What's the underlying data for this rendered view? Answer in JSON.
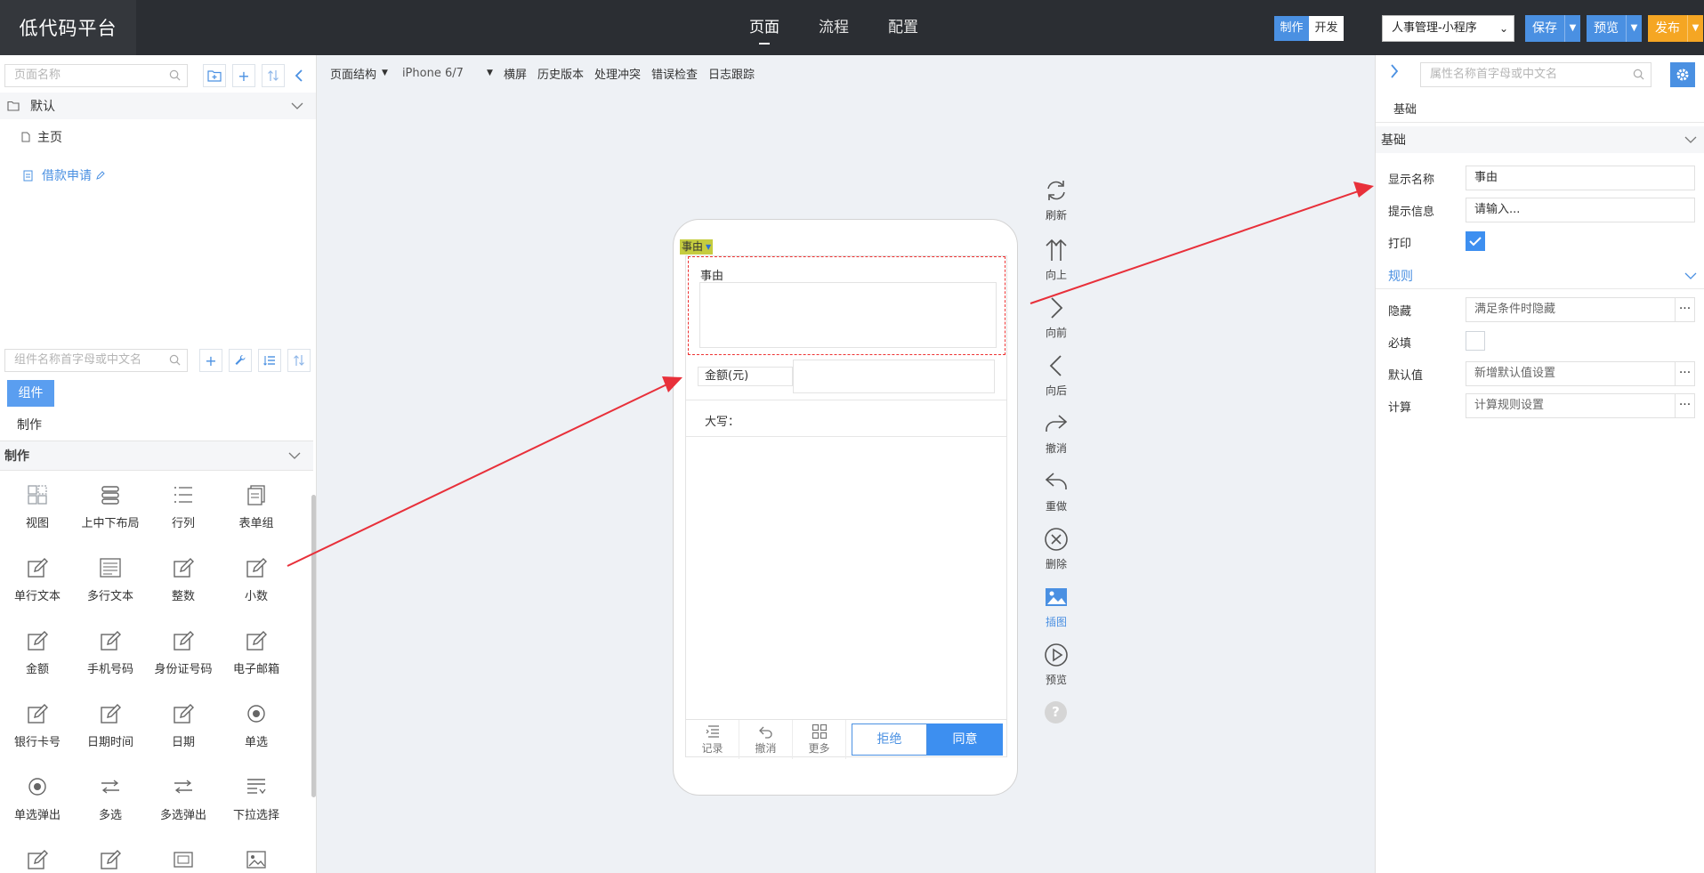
{
  "app": {
    "title": "低代码平台"
  },
  "nav": {
    "items": [
      "页面",
      "流程",
      "配置"
    ],
    "active": 0
  },
  "mode": {
    "make": "制作",
    "dev": "开发"
  },
  "app_select": {
    "value": "人事管理-小程序"
  },
  "actions": {
    "save": "保存",
    "preview": "预览",
    "publish": "发布"
  },
  "colors": {
    "accent": "#4a90e2",
    "publish": "#f5a623",
    "topbar": "#2b2e33",
    "selection": "#c5cc3f"
  },
  "left": {
    "page_search_placeholder": "页面名称",
    "tree": {
      "group": "默认",
      "home": "主页",
      "current": "借款申请"
    },
    "comp_search_placeholder": "组件名称首字母或中文名",
    "comp_tab": "组件",
    "comp_label": "制作",
    "category": "制作",
    "components": [
      {
        "label": "视图",
        "icon": "view-icon"
      },
      {
        "label": "上中下布局",
        "icon": "layout-icon"
      },
      {
        "label": "行列",
        "icon": "rows-icon"
      },
      {
        "label": "表单组",
        "icon": "form-group-icon"
      },
      {
        "label": "单行文本",
        "icon": "edit-icon"
      },
      {
        "label": "多行文本",
        "icon": "textarea-icon"
      },
      {
        "label": "整数",
        "icon": "edit-icon"
      },
      {
        "label": "小数",
        "icon": "edit-icon"
      },
      {
        "label": "金额",
        "icon": "edit-icon"
      },
      {
        "label": "手机号码",
        "icon": "edit-icon"
      },
      {
        "label": "身份证号码",
        "icon": "edit-icon"
      },
      {
        "label": "电子邮箱",
        "icon": "edit-icon"
      },
      {
        "label": "银行卡号",
        "icon": "edit-icon"
      },
      {
        "label": "日期时间",
        "icon": "edit-icon"
      },
      {
        "label": "日期",
        "icon": "edit-icon"
      },
      {
        "label": "单选",
        "icon": "radio-icon"
      },
      {
        "label": "单选弹出",
        "icon": "radio-icon"
      },
      {
        "label": "多选",
        "icon": "multi-icon"
      },
      {
        "label": "多选弹出",
        "icon": "multi-icon"
      },
      {
        "label": "下拉选择",
        "icon": "dropdown-icon"
      },
      {
        "label": "",
        "icon": "edit-icon"
      },
      {
        "label": "",
        "icon": "edit-icon"
      },
      {
        "label": "",
        "icon": "image-card-icon"
      },
      {
        "label": "",
        "icon": "image-icon"
      }
    ]
  },
  "toolbar": {
    "structure": "页面结构",
    "device": "iPhone 6/7",
    "landscape": "横屏",
    "history": "历史版本",
    "conflict": "处理冲突",
    "errors": "错误检查",
    "logs": "日志跟踪"
  },
  "phone": {
    "selected_tag": "事由",
    "reason_label": "事由",
    "amount_label": "金额(元)",
    "upper_label": "大写：",
    "bottom": {
      "record": "记录",
      "undo": "撤消",
      "more": "更多",
      "reject": "拒绝",
      "agree": "同意"
    }
  },
  "side_tools": [
    {
      "label": "刷新",
      "icon": "refresh-icon"
    },
    {
      "label": "向上",
      "icon": "up-icon"
    },
    {
      "label": "向前",
      "icon": "forward-icon"
    },
    {
      "label": "向后",
      "icon": "back-icon"
    },
    {
      "label": "撤消",
      "icon": "undo-icon"
    },
    {
      "label": "重做",
      "icon": "redo-icon"
    },
    {
      "label": "删除",
      "icon": "delete-icon"
    },
    {
      "label": "插图",
      "icon": "insert-image-icon"
    },
    {
      "label": "预览",
      "icon": "preview-icon"
    }
  ],
  "right": {
    "search_placeholder": "属性名称首字母或中文名",
    "tab": "基础",
    "section_basic": "基础",
    "display_name_label": "显示名称",
    "display_name_value": "事由",
    "hint_label": "提示信息",
    "hint_value": "请输入...",
    "print_label": "打印",
    "section_rules": "规则",
    "hide_label": "隐藏",
    "hide_value": "满足条件时隐藏",
    "required_label": "必填",
    "default_label": "默认值",
    "default_value": "新增默认值设置",
    "calc_label": "计算",
    "calc_value": "计算规则设置"
  }
}
